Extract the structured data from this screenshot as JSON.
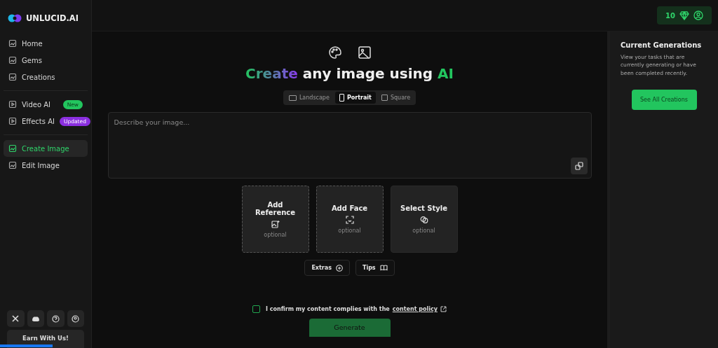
{
  "brand": "UNLUCID.AI",
  "nav_groups": [
    [
      {
        "label": "Home",
        "selected": false
      },
      {
        "label": "Gems",
        "selected": false
      },
      {
        "label": "Creations",
        "selected": false
      }
    ],
    [
      {
        "label": "Video AI",
        "selected": false,
        "badge": {
          "label": "New",
          "kind": "new"
        }
      },
      {
        "label": "Effects AI",
        "selected": false,
        "badge": {
          "label": "Updated",
          "kind": "updated"
        }
      }
    ],
    [
      {
        "label": "Create Image",
        "selected": true
      },
      {
        "label": "Edit Image",
        "selected": false
      }
    ]
  ],
  "earn_button": "Earn With Us!",
  "gems": {
    "count": "10"
  },
  "title": {
    "highlight": "Create",
    "text": "any image using",
    "accent": "AI"
  },
  "orientations": [
    {
      "label": "Landscape",
      "selected": false
    },
    {
      "label": "Portrait",
      "selected": true
    },
    {
      "label": "Square",
      "selected": false
    }
  ],
  "prompt": {
    "placeholder": "Describe your image..."
  },
  "cards": [
    {
      "title": "Add Reference",
      "hint": "optional",
      "kind": "dashed"
    },
    {
      "title": "Add Face",
      "hint": "optional",
      "kind": "dashed"
    },
    {
      "title": "Select Style",
      "hint": "optional",
      "kind": "solid"
    }
  ],
  "extras": [
    "Extras",
    "Tips"
  ],
  "consent": {
    "text": "I confirm my content complies with the",
    "link": "content policy",
    "checked": false
  },
  "generate_button": "Generate",
  "loading": {
    "level": 0.073
  },
  "panel": {
    "title": "Current Generations",
    "text": "View your tasks that are currently generating or have been completed recently.",
    "button": "See All Creations"
  }
}
